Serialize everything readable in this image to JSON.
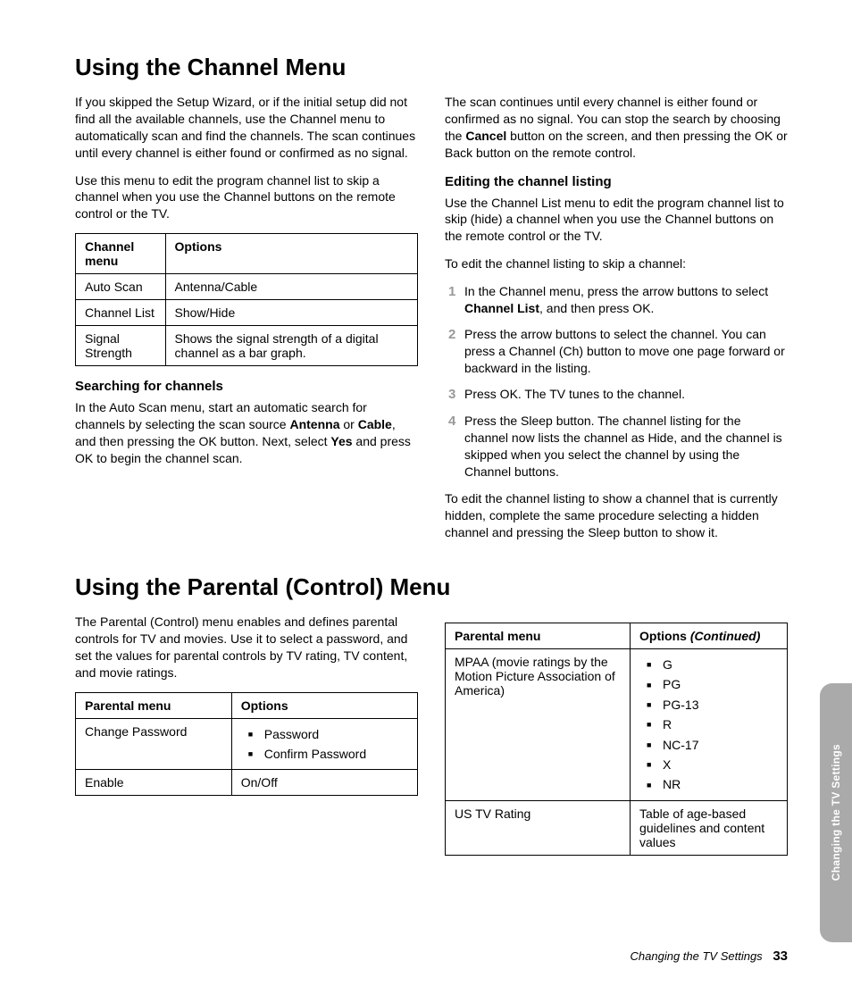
{
  "section1": {
    "heading": "Using the Channel Menu",
    "left": {
      "p1": "If you skipped the Setup Wizard, or if the initial setup did not find all the available channels, use the Channel menu to automatically scan and find the channels. The scan continues until every channel is either found or confirmed as no signal.",
      "p2": "Use this menu to edit the program channel list to skip a channel when you use the Channel buttons on the remote control or the TV.",
      "table": {
        "head": [
          "Channel menu",
          "Options"
        ],
        "rows": [
          [
            "Auto Scan",
            "Antenna/Cable"
          ],
          [
            "Channel List",
            "Show/Hide"
          ],
          [
            "Signal Strength",
            "Shows the signal strength of a digital channel as a bar graph."
          ]
        ]
      },
      "h3": "Searching for channels",
      "p3_pre": "In the Auto Scan menu, start an automatic search for channels by selecting the scan source ",
      "p3_b1": "Antenna",
      "p3_mid1": " or ",
      "p3_b2": "Cable",
      "p3_mid2": ", and then pressing the OK button. Next, select ",
      "p3_b3": "Yes",
      "p3_post": " and press OK to begin the channel scan."
    },
    "right": {
      "p1_pre": "The scan continues until every channel is either found or confirmed as no signal. You can stop the search by choosing the ",
      "p1_b": "Cancel",
      "p1_post": " button on the screen, and then pressing the OK or Back button on the remote control.",
      "h3": "Editing the channel listing",
      "p2": "Use the Channel List menu to edit the program channel list to skip (hide) a channel when you use the Channel buttons on the remote control or the TV.",
      "p3": "To edit the channel listing to skip a channel:",
      "steps": [
        {
          "n": "1",
          "pre": "In the Channel menu, press the arrow buttons to select ",
          "b": "Channel List",
          "post": ", and then press OK."
        },
        {
          "n": "2",
          "pre": "Press the arrow buttons to select the channel. You can press a Channel (Ch) button to move one page forward or backward in the listing.",
          "b": "",
          "post": ""
        },
        {
          "n": "3",
          "pre": "Press OK. The TV tunes to the channel.",
          "b": "",
          "post": ""
        },
        {
          "n": "4",
          "pre": "Press the Sleep button. The channel listing for the channel now lists the channel as Hide, and the channel is skipped when you select the channel by using the Channel buttons.",
          "b": "",
          "post": ""
        }
      ],
      "p4": "To edit the channel listing to show a channel that is currently hidden, complete the same procedure selecting a hidden channel and pressing the Sleep button to show it."
    }
  },
  "section2": {
    "heading": "Using the Parental (Control) Menu",
    "left": {
      "p1": "The Parental (Control) menu enables and defines parental controls for TV and movies. Use it to select a password, and set the values for parental controls by TV rating, TV content, and movie ratings.",
      "table": {
        "head": [
          "Parental menu",
          "Options"
        ],
        "rows": [
          {
            "menu": "Change Password",
            "opts_type": "list",
            "opts": [
              "Password",
              "Confirm Password"
            ]
          },
          {
            "menu": "Enable",
            "opts_type": "text",
            "opts": "On/Off"
          }
        ]
      }
    },
    "right": {
      "table": {
        "head_menu": "Parental menu",
        "head_opts": "Options",
        "head_cont": " (Continued)",
        "rows": [
          {
            "menu": "MPAA (movie ratings by the Motion Picture Association of America)",
            "opts_type": "list",
            "opts": [
              "G",
              "PG",
              "PG-13",
              "R",
              "NC-17",
              "X",
              "NR"
            ]
          },
          {
            "menu": "US TV Rating",
            "opts_type": "text",
            "opts": "Table of age-based guidelines and content values"
          }
        ]
      }
    }
  },
  "footer": {
    "chapter": "Changing the TV Settings",
    "page": "33"
  },
  "sidetab": "Changing the TV Settings"
}
